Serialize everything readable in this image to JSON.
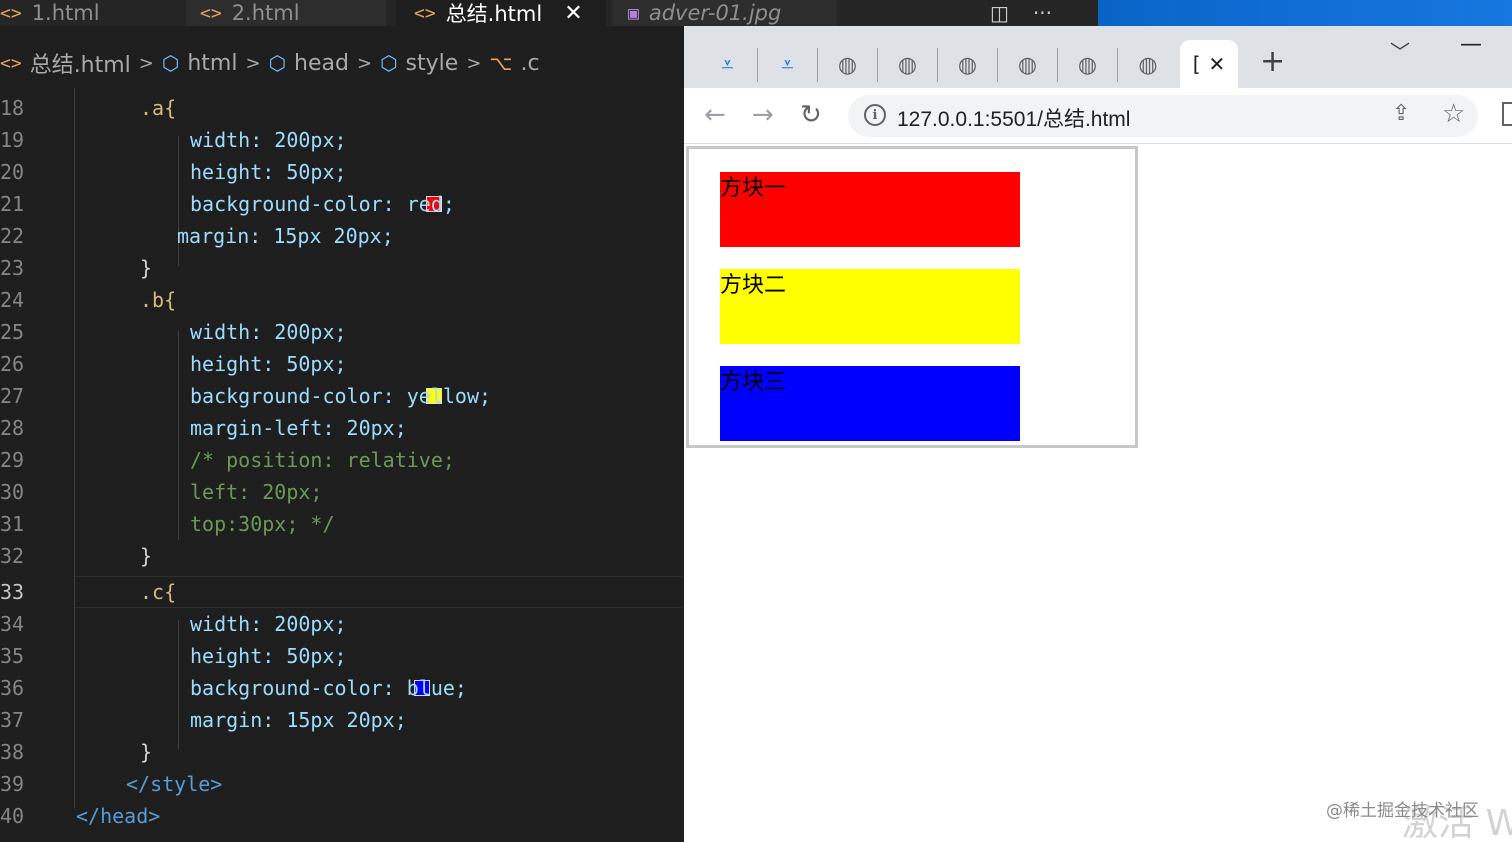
{
  "editor": {
    "tabs": [
      {
        "label": "1.html",
        "icon": "html-file-icon"
      },
      {
        "label": "2.html",
        "icon": "html-file-icon"
      },
      {
        "label": "总结.html",
        "icon": "html-file-icon",
        "active": true,
        "close": "✕"
      },
      {
        "label": "adver-01.jpg",
        "icon": "image-file-icon"
      }
    ],
    "more_actions": "···",
    "breadcrumb": [
      "总结.html",
      "html",
      "head",
      "style",
      ".c"
    ],
    "current_line": 33,
    "lines": [
      {
        "n": "18",
        "code": ".a{"
      },
      {
        "n": "19",
        "code": "width: 200px;"
      },
      {
        "n": "20",
        "code": "height: 50px;"
      },
      {
        "n": "21",
        "code": "background-color: red;"
      },
      {
        "n": "22",
        "code": "margin: 15px 20px;"
      },
      {
        "n": "23",
        "code": "}"
      },
      {
        "n": "24",
        "code": ".b{"
      },
      {
        "n": "25",
        "code": "width: 200px;"
      },
      {
        "n": "26",
        "code": "height: 50px;"
      },
      {
        "n": "27",
        "code": "background-color: yellow;"
      },
      {
        "n": "28",
        "code": "margin-left: 20px;"
      },
      {
        "n": "29",
        "code": "/* position: relative;"
      },
      {
        "n": "30",
        "code": "left: 20px;"
      },
      {
        "n": "31",
        "code": "top:30px; */"
      },
      {
        "n": "32",
        "code": "}"
      },
      {
        "n": "33",
        "code": ".c{"
      },
      {
        "n": "34",
        "code": "width: 200px;"
      },
      {
        "n": "35",
        "code": "height: 50px;"
      },
      {
        "n": "36",
        "code": "background-color: blue;"
      },
      {
        "n": "37",
        "code": "margin: 15px 20px;"
      },
      {
        "n": "38",
        "code": "}"
      },
      {
        "n": "39",
        "code": "</style>"
      },
      {
        "n": "40",
        "code": "</head>"
      }
    ],
    "colors": {
      "red": "#ff0000",
      "yellow": "#ffff00",
      "blue": "#0000ff"
    }
  },
  "browser": {
    "active_tab_label": "[",
    "active_tab_close": "✕",
    "new_tab": "+",
    "url": "127.0.0.1:5501/总结.html",
    "blocks": [
      {
        "label": "方块一",
        "color": "#ff0000"
      },
      {
        "label": "方块二",
        "color": "#ffff00"
      },
      {
        "label": "方块三",
        "color": "#0000ff"
      }
    ]
  },
  "overlay": {
    "watermark": "@稀土掘金技术社区",
    "activate": "激活 Wi"
  }
}
